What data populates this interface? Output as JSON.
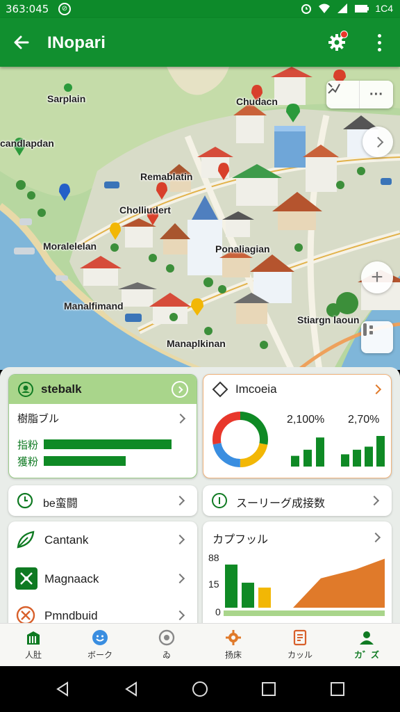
{
  "status": {
    "time": "363:045",
    "battery": "1C4"
  },
  "appbar": {
    "title": "INopari"
  },
  "map": {
    "labels": [
      "Sarplain",
      "Chudacn",
      "candlapdan",
      "Remablatin",
      "Cholliudert",
      "Moralelelan",
      "Ponaliagian",
      "Manalfimand",
      "Stiargn laoun",
      "Manaplkinan"
    ]
  },
  "cards": {
    "status_card": {
      "title": "stebalk",
      "row_label": "樹脂ブル",
      "bar1_label": "指粉",
      "bar2_label": "獲粉",
      "bar1_value": 0.75,
      "bar2_value": 0.48
    },
    "insight_card": {
      "title": "Imcoeia",
      "pct1": "2,100%",
      "pct2": "2,70%",
      "donut": [
        0.28,
        0.22,
        0.22,
        0.28
      ],
      "bars1": [
        0.35,
        0.55,
        0.95
      ],
      "bars2": [
        0.4,
        0.55,
        0.65,
        1.0
      ]
    },
    "clock_row": {
      "label": "be蛮闘"
    },
    "series_row": {
      "label": "スーリーグ成接数"
    },
    "list": [
      {
        "label": "Cantank",
        "icon": "leaf-icon"
      },
      {
        "label": "Magnaack",
        "icon": "tools-icon"
      },
      {
        "label": "Pmndbuid",
        "icon": "wrench-icon"
      }
    ],
    "chart_card": {
      "title": "カプフッル",
      "yticks": [
        "88",
        "15",
        "0"
      ]
    }
  },
  "chart_data": {
    "type": "bar",
    "categories": [
      "",
      "",
      ""
    ],
    "values": [
      88,
      51,
      41
    ],
    "area_series": [
      0,
      0,
      60,
      78,
      100
    ],
    "ylim": [
      0,
      100
    ],
    "title": "カプフッル"
  },
  "bottomnav": [
    {
      "label": "人肚",
      "icon": "building-icon"
    },
    {
      "label": "ボーク",
      "icon": "smile-icon"
    },
    {
      "label": "ゐ",
      "icon": "settings-icon"
    },
    {
      "label": "扬床",
      "icon": "gear-icon"
    },
    {
      "label": "カッル",
      "icon": "document-icon"
    },
    {
      "label": "カ゛ズ",
      "icon": "person-icon"
    }
  ],
  "colors": {
    "primary": "#118f2f",
    "accent_orange": "#e07a2a",
    "bar_green": "#0f8a25",
    "bar_yellow": "#f2b705"
  }
}
